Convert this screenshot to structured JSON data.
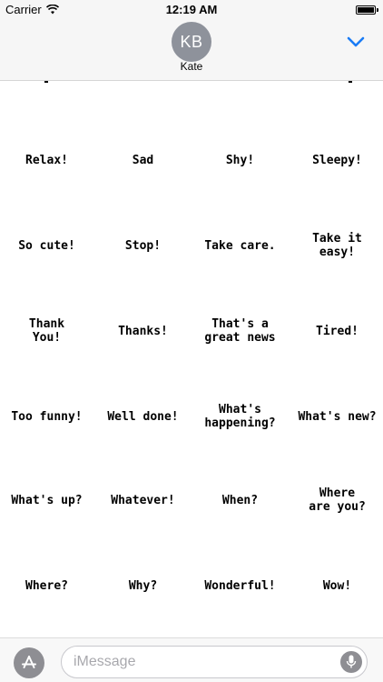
{
  "status_bar": {
    "carrier": "Carrier",
    "time": "12:19 AM"
  },
  "header": {
    "avatar_initials": "KB",
    "contact_name": "Kate"
  },
  "stickers": [
    [
      "Relax!",
      "Sad",
      "Shy!",
      "Sleepy!"
    ],
    [
      "So cute!",
      "Stop!",
      "Take care.",
      "Take it\neasy!"
    ],
    [
      "Thank\nYou!",
      "Thanks!",
      "That's a\ngreat news",
      "Tired!"
    ],
    [
      "Too funny!",
      "Well done!",
      "What's\nhappening?",
      "What's new?"
    ],
    [
      "What's up?",
      "Whatever!",
      "When?",
      "Where\nare you?"
    ],
    [
      "Where?",
      "Why?",
      "Wonderful!",
      "Wow!"
    ]
  ],
  "compose": {
    "placeholder": "iMessage"
  },
  "colors": {
    "accent": "#1a7cf5",
    "avatar_bg": "#8e929b",
    "bar_bg": "#f6f6f6"
  },
  "icons": {
    "signal": "wifi-icon",
    "battery": "battery-icon",
    "collapse": "chevron-down-icon",
    "apps": "app-store-icon",
    "dictation": "microphone-icon"
  }
}
